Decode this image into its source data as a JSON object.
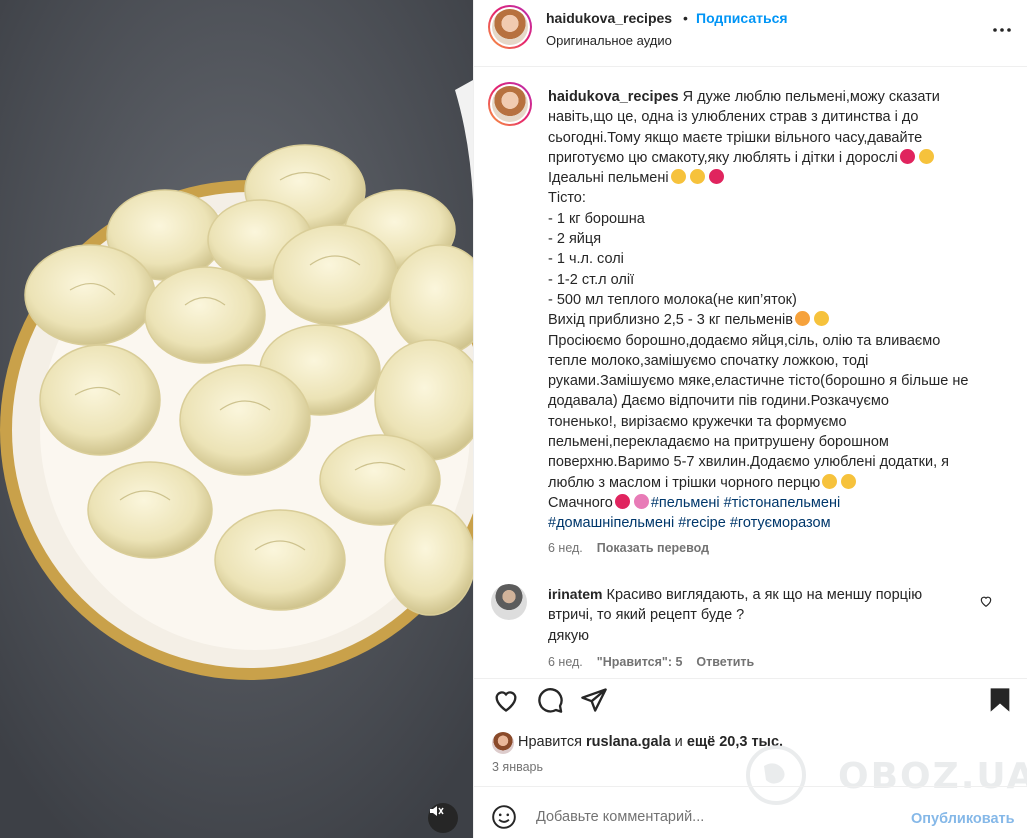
{
  "header": {
    "username": "haidukova_recipes",
    "separator": "•",
    "follow": "Подписаться",
    "audio": "Оригинальное аудио"
  },
  "caption": {
    "username": "haidukova_recipes",
    "lines": [
      "Я дуже люблю пельмені,можу сказати",
      "навіть,що це, одна із улюблених страв з дитинства і до",
      "сьогодні.Тому якщо маєте трішки вільного часу,давайте",
      "приготуємо цю смакоту,яку люблять і дітки і дорослі",
      "Ідеальні пельмені",
      "Тісто:",
      "- 1 кг борошна",
      "- 2 яйця",
      "- 1 ч.л. солі",
      "- 1-2 ст.л олії",
      "- 500 мл теплого молока(не кип’яток)",
      "Вихід приблизно 2,5 - 3 кг пельменів",
      "Просіюємо борошно,додаємо яйця,сіль, олію та вливаємо",
      "тепле молоко,замішуємо спочатку ложкою, тоді",
      "руками.Замішуємо мяке,еластичне тісто(борошно я більше не",
      "додавала) Даємо відпочити пів години.Розкачуємо",
      "тоненько!, вирізаємо кружечки та формуємо",
      "пельмені,перекладаємо на притрушену борошном",
      "поверхню.Варимо 5-7 хвилин.Додаємо улюблені додатки, я",
      "люблю з маслом і трішки чорного перцю",
      "Смачного"
    ],
    "hashtags": [
      "#пельмені",
      "#тістонапельмені",
      "#домашніпельмені",
      "#recipe",
      "#готуєморазом"
    ],
    "age": "6 нед.",
    "translate": "Показать перевод"
  },
  "comment": {
    "username": "irinatem",
    "text": "Красиво виглядають, а як що на меншу порцію",
    "text2": "втричі, то який рецепт буде ?",
    "text3": "дякую",
    "age": "6 нед.",
    "likes": "\"Нравится\": 5",
    "reply": "Ответить"
  },
  "likes": {
    "prefix": "Нравится",
    "user": "ruslana.gala",
    "mid": "и",
    "rest": "ещё 20,3 тыс."
  },
  "date": "3 январь",
  "add_comment": {
    "placeholder": "Добавьте комментарий...",
    "publish": "Опубликовать"
  },
  "watermark": "OBOZ.UA",
  "colors": {
    "accent": "#0095f6",
    "publish": "#85b8e8",
    "heart": "#e0245e"
  },
  "icons": [
    "more-icon",
    "heart-icon",
    "comment-icon",
    "share-icon",
    "bookmark-icon",
    "emoji-icon",
    "mute-icon"
  ]
}
